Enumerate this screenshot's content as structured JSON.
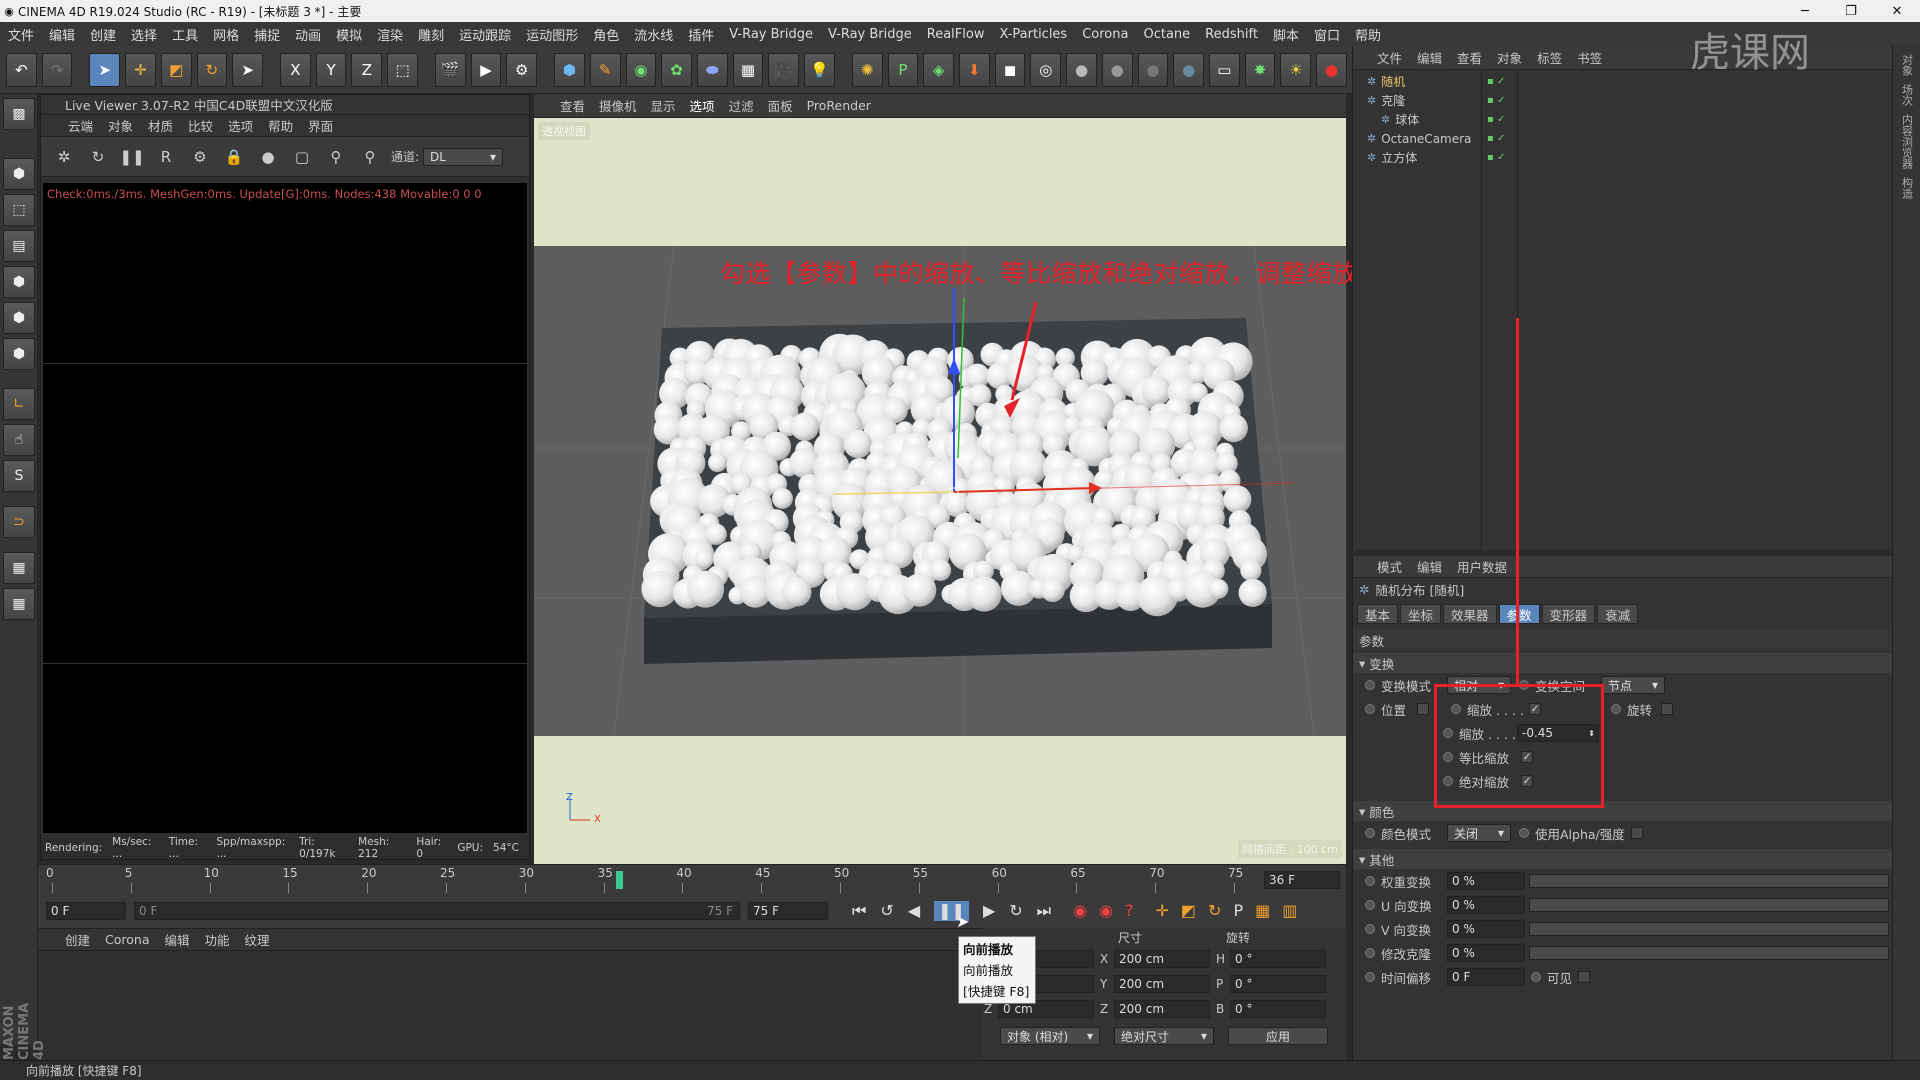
{
  "window": {
    "title": "CINEMA 4D R19.024 Studio (RC - R19) - [未标题 3 *] - 主要"
  },
  "menubar": [
    "文件",
    "编辑",
    "创建",
    "选择",
    "工具",
    "网格",
    "捕捉",
    "动画",
    "模拟",
    "渲染",
    "雕刻",
    "运动跟踪",
    "运动图形",
    "角色",
    "流水线",
    "插件",
    "V-Ray Bridge",
    "V-Ray Bridge",
    "RealFlow",
    "X-Particles",
    "Corona",
    "Octane",
    "Redshift",
    "脚本",
    "窗口",
    "帮助"
  ],
  "toolbar": {
    "xyz": [
      "X",
      "Y",
      "Z"
    ]
  },
  "liveviewer": {
    "title": "Live Viewer 3.07-R2 中国C4D联盟中文汉化版",
    "menu": [
      "云端",
      "对象",
      "材质",
      "比较",
      "选项",
      "帮助",
      "界面"
    ],
    "channel_label": "通道:",
    "channel_value": "DL",
    "info": "Check:0ms./3ms. MeshGen:0ms. Update[G]:0ms. Nodes:438 Movable:0  0 0",
    "status": [
      "Rendering:",
      "Ms/sec: ...",
      "Time: ...",
      "Spp/maxspp: ...",
      "Tri: 0/197k",
      "Mesh: 212",
      "Hair: 0",
      "GPU:",
      "54°C"
    ]
  },
  "viewport": {
    "menu": [
      "查看",
      "摄像机",
      "显示",
      "选项",
      "过滤",
      "面板",
      "ProRender"
    ],
    "label_tl": "透视视图",
    "grid_label": "网格间距 : 100 cm",
    "axis_z": "Z",
    "axis_x": "X"
  },
  "annotation": "勾选【参数】中的缩放、等比缩放和绝对缩放，调整缩放为-0.45，使球体具有随机大小",
  "timeline": {
    "ticks": [
      "0",
      "5",
      "10",
      "15",
      "20",
      "25",
      "30",
      "35",
      "40",
      "45",
      "50",
      "55",
      "60",
      "65",
      "70",
      "75"
    ],
    "current_frame": "36 F",
    "start_frame": "0 F",
    "range_start": "0 F",
    "range_end": "75 F",
    "end_frame": "75 F",
    "playhead": 36,
    "max": 75
  },
  "tooltip": {
    "title": "向前播放",
    "line1": "向前播放",
    "line2": "[快捷键 F8]"
  },
  "material": {
    "menu": [
      "创建",
      "Corona",
      "编辑",
      "功能",
      "纹理"
    ]
  },
  "coords": {
    "headers": [
      "尺寸",
      "旋转"
    ],
    "rows": [
      {
        "axis": "X",
        "pos": "",
        "size_axis": "X",
        "size": "200 cm",
        "rot_axis": "H",
        "rot": "0 °"
      },
      {
        "axis": "Y",
        "pos": "",
        "size_axis": "Y",
        "size": "200 cm",
        "rot_axis": "P",
        "rot": "0 °"
      },
      {
        "axis": "Z",
        "pos": "0 cm",
        "size_axis": "Z",
        "size": "200 cm",
        "rot_axis": "B",
        "rot": "0 °"
      }
    ],
    "mode1": "对象 (相对)",
    "mode2": "绝对尺寸",
    "apply": "应用"
  },
  "objmgr": {
    "menu": [
      "文件",
      "编辑",
      "查看",
      "对象",
      "标签",
      "书签"
    ],
    "items": [
      {
        "name": "随机",
        "indent": 0,
        "color": "#e8c070"
      },
      {
        "name": "克隆",
        "indent": 0,
        "color": "#c8c8c8"
      },
      {
        "name": "球体",
        "indent": 1,
        "color": "#c8c8c8"
      },
      {
        "name": "OctaneCamera",
        "indent": 0,
        "color": "#c8c8c8"
      },
      {
        "name": "立方体",
        "indent": 0,
        "color": "#c8c8c8"
      }
    ]
  },
  "attr": {
    "menu": [
      "模式",
      "编辑",
      "用户数据"
    ],
    "object_title": "随机分布 [随机]",
    "tabs": [
      "基本",
      "坐标",
      "效果器",
      "参数",
      "变形器",
      "衰减"
    ],
    "active_tab": 3,
    "section_params": "参数",
    "section_transform": "变换",
    "transform_mode_label": "变换模式",
    "transform_mode_value": "相对",
    "transform_space_label": "变换空间",
    "transform_space_value": "节点",
    "position_label": "位置",
    "scale_label": "缩放 . . . .",
    "scale_check": "✓",
    "rotate_label": "旋转",
    "scale_value_label": "缩放 . . . .",
    "scale_value": "-0.45",
    "uniform_label": "等比缩放",
    "uniform_check": "✓",
    "absolute_label": "绝对缩放",
    "absolute_check": "✓",
    "section_color": "颜色",
    "color_mode_label": "颜色模式",
    "color_mode_value": "关闭",
    "use_alpha_label": "使用Alpha/强度",
    "section_other": "其他",
    "other": [
      {
        "label": "权重变换",
        "value": "0 %"
      },
      {
        "label": "U 向变换",
        "value": "0 %"
      },
      {
        "label": "V 向变换",
        "value": "0 %"
      },
      {
        "label": "修改克隆",
        "value": "0 %"
      }
    ],
    "time_offset_label": "时间偏移",
    "time_offset_value": "0 F",
    "visible_label": "可见"
  },
  "rightstrip": [
    "对象",
    "场次",
    "内容浏览器",
    "构造"
  ],
  "statusbar": "向前播放 [快捷键 F8]",
  "brand": "MAXON CINEMA 4D",
  "watermark": "虎课网"
}
